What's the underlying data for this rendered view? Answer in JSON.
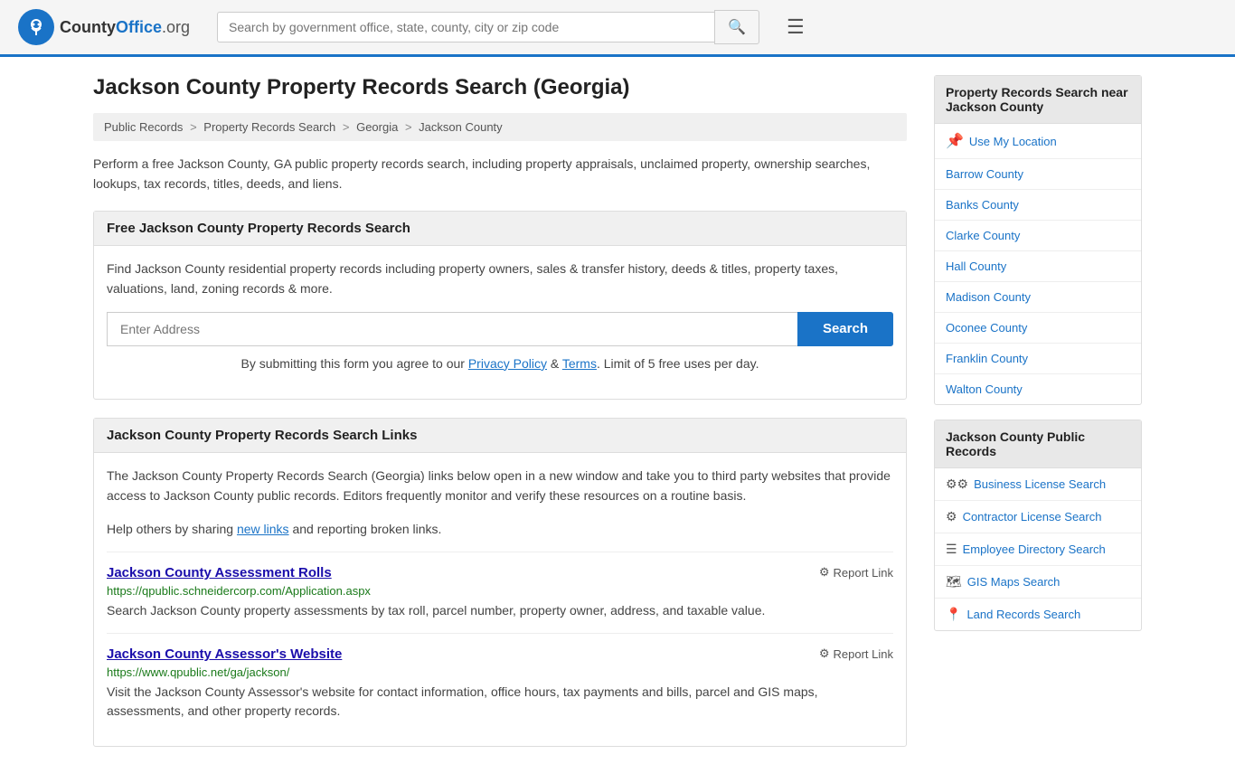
{
  "header": {
    "logo_text": "CountyOffice",
    "logo_domain": ".org",
    "search_placeholder": "Search by government office, state, county, city or zip code"
  },
  "page": {
    "title": "Jackson County Property Records Search (Georgia)",
    "breadcrumb": [
      {
        "label": "Public Records",
        "href": "#"
      },
      {
        "label": "Property Records Search",
        "href": "#"
      },
      {
        "label": "Georgia",
        "href": "#"
      },
      {
        "label": "Jackson County",
        "href": "#"
      }
    ],
    "description": "Perform a free Jackson County, GA public property records search, including property appraisals, unclaimed property, ownership searches, lookups, tax records, titles, deeds, and liens."
  },
  "free_search": {
    "heading": "Free Jackson County Property Records Search",
    "description": "Find Jackson County residential property records including property owners, sales & transfer history, deeds & titles, property taxes, valuations, land, zoning records & more.",
    "input_placeholder": "Enter Address",
    "search_button": "Search",
    "disclaimer": "By submitting this form you agree to our",
    "privacy_link": "Privacy Policy",
    "terms_link": "Terms",
    "limit_text": "Limit of 5 free uses per day."
  },
  "links_section": {
    "heading": "Jackson County Property Records Search Links",
    "description": "The Jackson County Property Records Search (Georgia) links below open in a new window and take you to third party websites that provide access to Jackson County public records. Editors frequently monitor and verify these resources on a routine basis.",
    "share_text": "Help others by sharing",
    "share_link_label": "new links",
    "share_end": "and reporting broken links.",
    "links": [
      {
        "title": "Jackson County Assessment Rolls",
        "url": "https://qpublic.schneidercorp.com/Application.aspx",
        "description": "Search Jackson County property assessments by tax roll, parcel number, property owner, address, and taxable value.",
        "report": "Report Link"
      },
      {
        "title": "Jackson County Assessor's Website",
        "url": "https://www.qpublic.net/ga/jackson/",
        "description": "Visit the Jackson County Assessor's website for contact information, office hours, tax payments and bills, parcel and GIS maps, assessments, and other property records.",
        "report": "Report Link"
      }
    ]
  },
  "sidebar": {
    "nearby_title": "Property Records Search near Jackson County",
    "use_location": "Use My Location",
    "nearby_counties": [
      "Barrow County",
      "Banks County",
      "Clarke County",
      "Hall County",
      "Madison County",
      "Oconee County",
      "Franklin County",
      "Walton County"
    ],
    "public_records_title": "Jackson County Public Records",
    "public_records": [
      {
        "icon": "⚙⚙",
        "label": "Business License Search"
      },
      {
        "icon": "⚙",
        "label": "Contractor License Search"
      },
      {
        "icon": "☰",
        "label": "Employee Directory Search"
      },
      {
        "icon": "🗺",
        "label": "GIS Maps Search"
      },
      {
        "icon": "📍",
        "label": "Land Records Search"
      }
    ]
  }
}
